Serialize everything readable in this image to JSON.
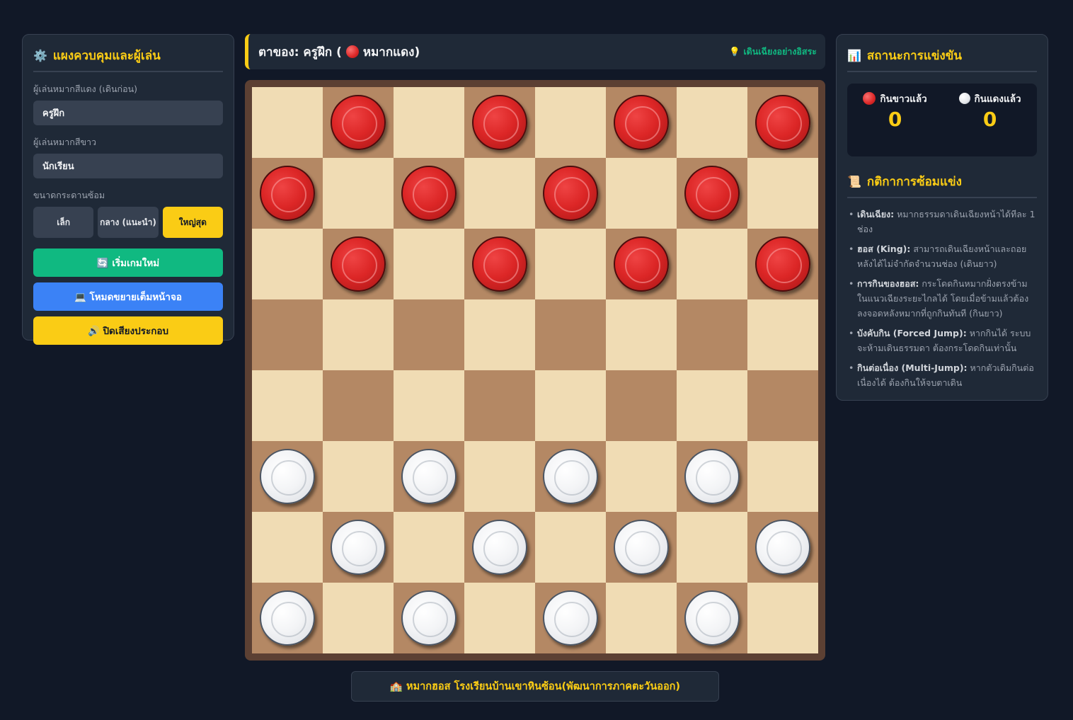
{
  "left_panel": {
    "title": "แผงควบคุมและผู้เล่น",
    "title_icon": "gear-icon",
    "red_player_label": "ผู้เล่นหมากสีแดง (เดินก่อน)",
    "red_player_value": "ครูฝึก",
    "white_player_label": "ผู้เล่นหมากสีขาว",
    "white_player_value": "นักเรียน",
    "board_size_label": "ขนาดกระดานซ้อม",
    "board_sizes": [
      "เล็ก",
      "กลาง (แนะนำ)",
      "ใหญ่สุด"
    ],
    "selected_board_size": "ใหญ่สุด",
    "new_game_label": "🔄 เริ่มเกมใหม่",
    "fullscreen_label": "💻 โหมดขยายเต็มหน้าจอ",
    "sound_label": "🔊 ปิดเสียงประกอบ"
  },
  "turn": {
    "prefix": "ตาของ: ครูฝึก (",
    "piece_name": "หมากแดง)",
    "hint_icon": "lightbulb-icon",
    "hint": "💡 เดินเฉียงอย่างอิสระ"
  },
  "board": {
    "size": 8,
    "pieces": [
      {
        "row": 0,
        "col": 1,
        "color": "red"
      },
      {
        "row": 0,
        "col": 3,
        "color": "red"
      },
      {
        "row": 0,
        "col": 5,
        "color": "red"
      },
      {
        "row": 0,
        "col": 7,
        "color": "red"
      },
      {
        "row": 1,
        "col": 0,
        "color": "red"
      },
      {
        "row": 1,
        "col": 2,
        "color": "red"
      },
      {
        "row": 1,
        "col": 4,
        "color": "red"
      },
      {
        "row": 1,
        "col": 6,
        "color": "red"
      },
      {
        "row": 2,
        "col": 1,
        "color": "red"
      },
      {
        "row": 2,
        "col": 3,
        "color": "red"
      },
      {
        "row": 2,
        "col": 5,
        "color": "red"
      },
      {
        "row": 2,
        "col": 7,
        "color": "red"
      },
      {
        "row": 5,
        "col": 0,
        "color": "white"
      },
      {
        "row": 5,
        "col": 2,
        "color": "white"
      },
      {
        "row": 5,
        "col": 4,
        "color": "white"
      },
      {
        "row": 5,
        "col": 6,
        "color": "white"
      },
      {
        "row": 6,
        "col": 1,
        "color": "white"
      },
      {
        "row": 6,
        "col": 3,
        "color": "white"
      },
      {
        "row": 6,
        "col": 5,
        "color": "white"
      },
      {
        "row": 6,
        "col": 7,
        "color": "white"
      },
      {
        "row": 7,
        "col": 0,
        "color": "white"
      },
      {
        "row": 7,
        "col": 2,
        "color": "white"
      },
      {
        "row": 7,
        "col": 4,
        "color": "white"
      },
      {
        "row": 7,
        "col": 6,
        "color": "white"
      }
    ],
    "colors": {
      "light": "#f0dcb4",
      "dark": "#b48864",
      "red_piece": "#dc2626",
      "white_piece": "#f3f4f6"
    }
  },
  "footer": {
    "icon": "school-icon",
    "text": "🏫 หมากฮอส โรงเรียนบ้านเขาหินซ้อน(พัฒนาการภาคตะวันออก)"
  },
  "right_panel": {
    "title": "สถานะการแข่งขัน",
    "title_icon": "chart-icon",
    "red_captured_label": "กินขาวแล้ว",
    "red_captured_value": "0",
    "white_captured_label": "กินแดงแล้ว",
    "white_captured_value": "0",
    "rules_title": "กติกาการซ้อมแข่ง",
    "rules_icon": "scroll-icon",
    "rules": [
      {
        "term": "เดินเฉียง:",
        "text": " หมากธรรมดาเดินเฉียงหน้าได้ทีละ 1 ช่อง"
      },
      {
        "term": "ฮอส (King):",
        "text": " สามารถเดินเฉียงหน้าและถอยหลังได้ไม่จำกัดจำนวนช่อง (เดินยาว)"
      },
      {
        "term": "การกินของฮอส:",
        "text": " กระโดดกินหมากฝั่งตรงข้ามในแนวเฉียงระยะไกลได้ โดยเมื่อข้ามแล้วต้องลงจอดหลังหมากที่ถูกกินทันที (กินยาว)"
      },
      {
        "term": "บังคับกิน (Forced Jump):",
        "text": " หากกินได้ ระบบจะห้ามเดินธรรมดา ต้องกระโดดกินเท่านั้น"
      },
      {
        "term": "กินต่อเนื่อง (Multi-Jump):",
        "text": " หากตัวเดิมกินต่อเนื่องได้ ต้องกินให้จบตาเดิน"
      }
    ]
  }
}
